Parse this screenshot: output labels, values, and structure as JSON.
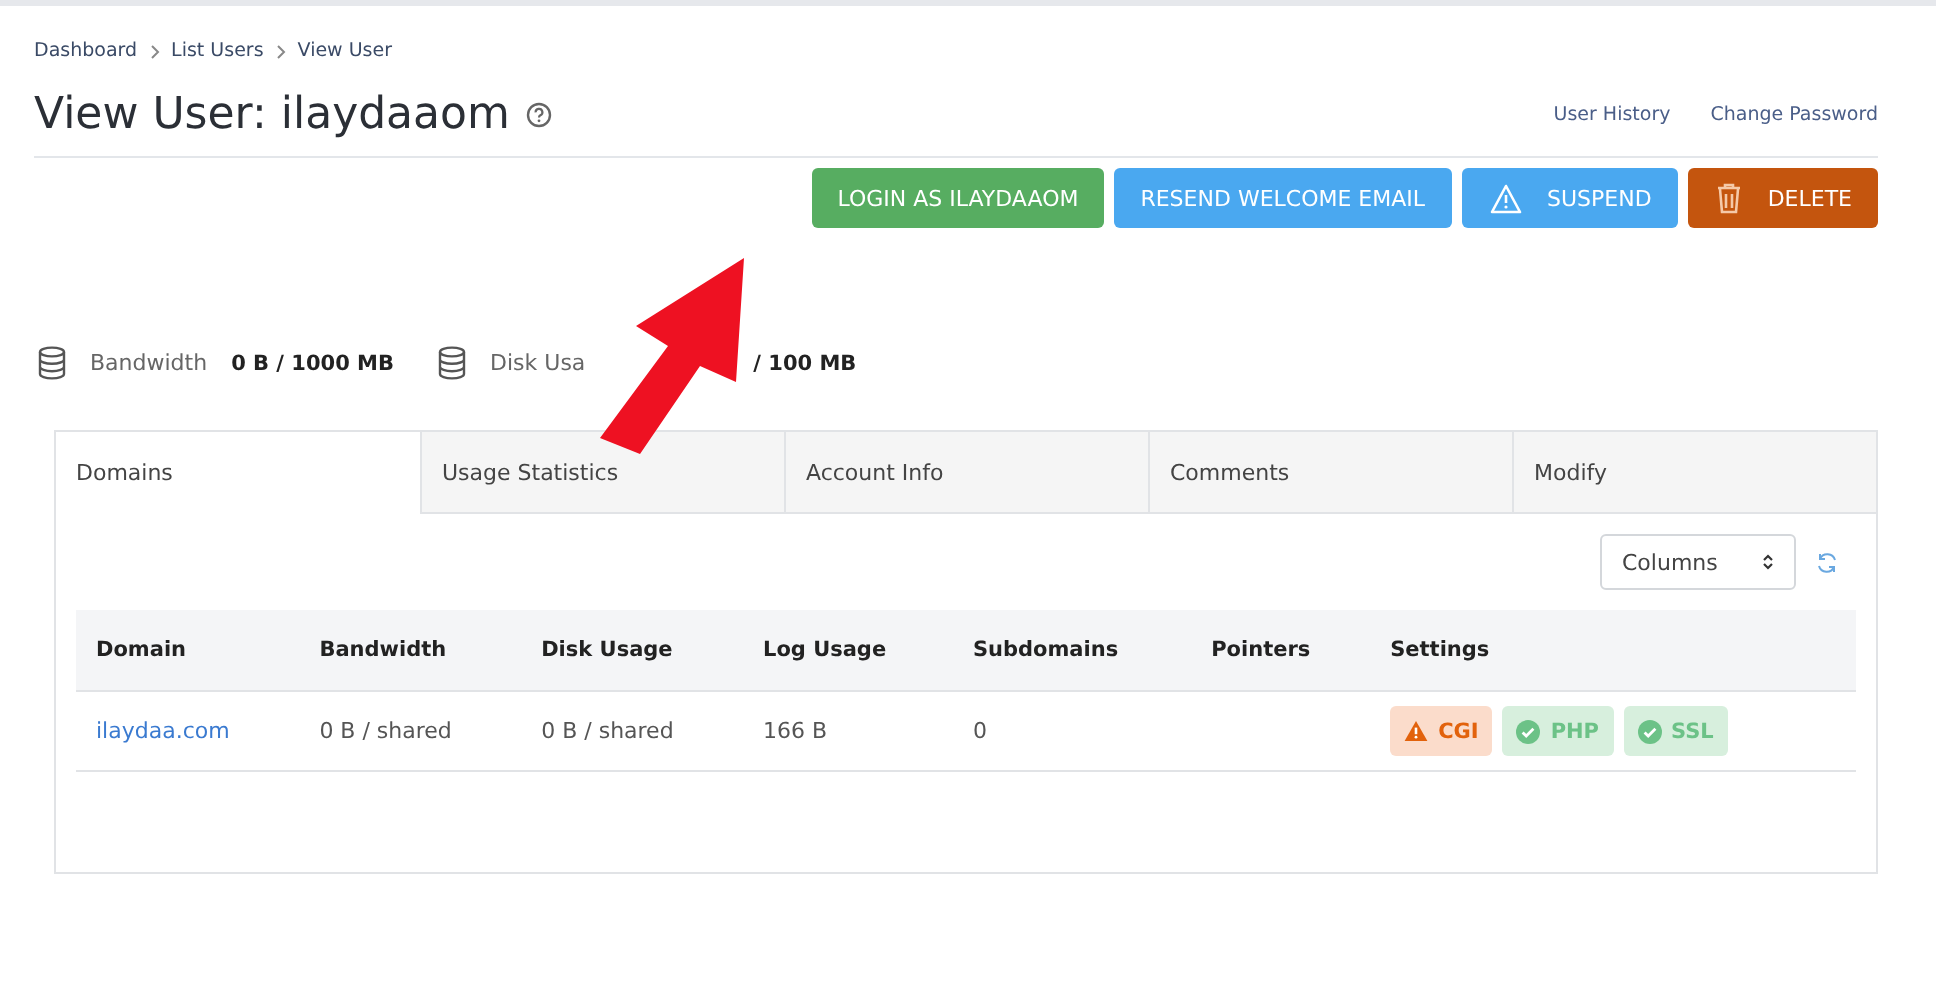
{
  "breadcrumbs": [
    "Dashboard",
    "List Users",
    "View User"
  ],
  "title": "View User: ilaydaaom",
  "header_links": [
    "User History",
    "Change Password"
  ],
  "buttons": [
    {
      "label": "LOGIN AS ILAYDAAOM",
      "kind": "login"
    },
    {
      "label": "RESEND WELCOME EMAIL",
      "kind": "resend"
    },
    {
      "label": "SUSPEND",
      "kind": "suspend"
    },
    {
      "label": "DELETE",
      "kind": "delete"
    }
  ],
  "usage": [
    {
      "label": "Bandwidth",
      "value": "0 B / 1000 MB"
    },
    {
      "label": "Disk Usa",
      "value": "/ 100 MB"
    }
  ],
  "tabs": [
    {
      "label": "Domains",
      "selected": true
    },
    {
      "label": "Usage Statistics",
      "selected": false
    },
    {
      "label": "Account Info",
      "selected": false
    },
    {
      "label": "Comments",
      "selected": false
    },
    {
      "label": "Modify",
      "selected": false
    }
  ],
  "columns_control": "Columns",
  "table": {
    "columns": [
      "Domain",
      "Bandwidth",
      "Disk Usage",
      "Log Usage",
      "Subdomains",
      "Pointers",
      "Settings"
    ],
    "rows": [
      {
        "domain": "ilaydaa.com",
        "bandwidth": "0 B / shared",
        "disk_usage": "0 B / shared",
        "log_usage": "166 B",
        "subdomains": "0",
        "settings": [
          {
            "label": "CGI",
            "kind": "warning"
          },
          {
            "label": "PHP",
            "kind": "success"
          },
          {
            "label": "SSL",
            "kind": "success"
          }
        ]
      }
    ]
  }
}
